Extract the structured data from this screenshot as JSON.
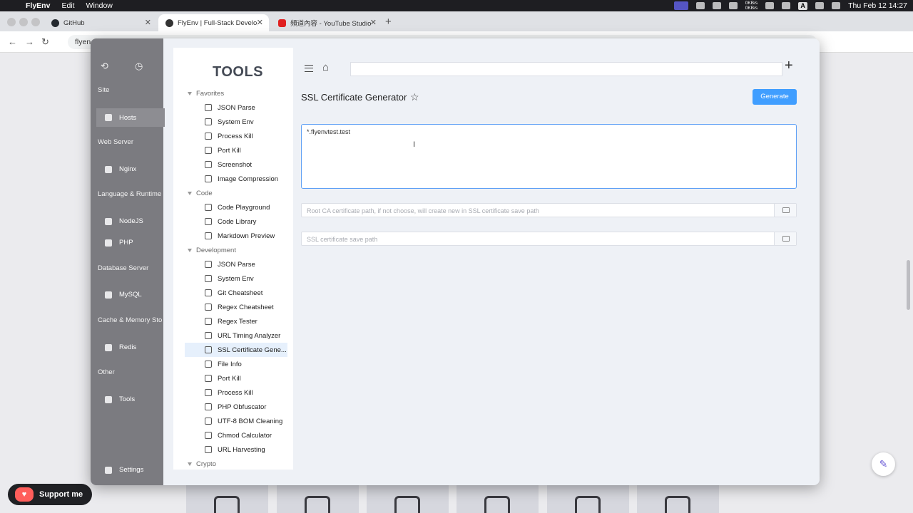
{
  "menubar": {
    "app": "FlyEnv",
    "items": [
      "Edit",
      "Window"
    ],
    "net_up": "0KB/s",
    "net_down": "0KB/s",
    "input_source": "A",
    "clock": "Thu Feb 12  14:27"
  },
  "browser": {
    "tabs": [
      {
        "title": "GitHub"
      },
      {
        "title": "FlyEnv | Full-Stack Developm"
      },
      {
        "title": "頻道內容 - YouTube Studio"
      }
    ],
    "address": "flyen"
  },
  "app_sidebar": {
    "groups": [
      {
        "label": "Site",
        "items": [
          "Hosts"
        ]
      },
      {
        "label": "Web Server",
        "items": [
          "Nginx"
        ]
      },
      {
        "label": "Language & Runtime",
        "items": [
          "NodeJS",
          "PHP"
        ]
      },
      {
        "label": "Database Server",
        "items": [
          "MySQL"
        ]
      },
      {
        "label": "Cache & Memory Sto",
        "items": [
          "Redis"
        ]
      },
      {
        "label": "Other",
        "items": [
          "Tools"
        ]
      }
    ],
    "settings": "Settings"
  },
  "tools": {
    "title": "TOOLS",
    "categories": {
      "favorites": "Favorites",
      "code": "Code",
      "development": "Development",
      "crypto": "Crypto"
    },
    "favorites": [
      "JSON Parse",
      "System Env",
      "Process Kill",
      "Port Kill",
      "Screenshot",
      "Image Compression"
    ],
    "code": [
      "Code Playground",
      "Code Library",
      "Markdown Preview"
    ],
    "development": [
      "JSON Parse",
      "System Env",
      "Git Cheatsheet",
      "Regex Cheatsheet",
      "Regex Tester",
      "URL Timing Analyzer",
      "SSL Certificate Gene...",
      "File Info",
      "Port Kill",
      "Process Kill",
      "PHP Obfuscator",
      "UTF-8 BOM Cleaning",
      "Chmod Calculator",
      "URL Harvesting"
    ],
    "active_item": "SSL Certificate Gene..."
  },
  "main": {
    "page_title": "SSL Certificate Generator",
    "generate_label": "Generate",
    "domains_value": "*.flyenvtest.test",
    "root_ca_placeholder": "Root CA certificate path, if not choose, will create new in SSL certificate save path",
    "save_path_placeholder": "SSL certificate save path"
  },
  "page_bg": {
    "support_label": "Support me"
  },
  "colors": {
    "accent": "#409eff",
    "sidebar": "#7b7b80",
    "active_item": "#e6f0fc"
  }
}
